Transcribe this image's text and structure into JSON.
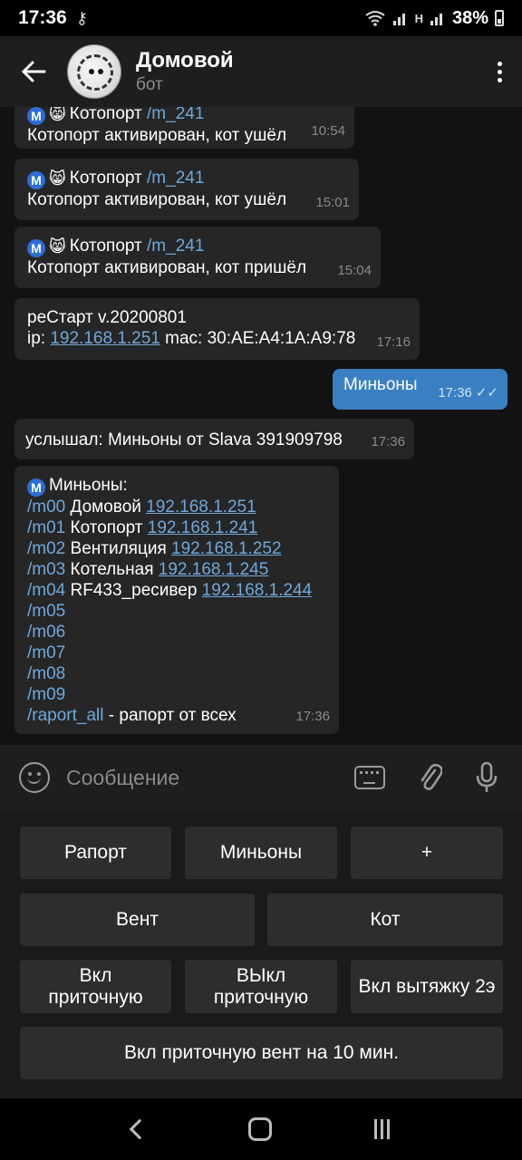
{
  "status_bar": {
    "time": "17:36",
    "battery": "38%",
    "signal_h": "H"
  },
  "header": {
    "title": "Домовой",
    "subtitle": "бот"
  },
  "messages": [
    {
      "lines": [
        {
          "badge": "M",
          "emoji": "😸",
          "text": "Котопорт",
          "link": "/m_241"
        },
        {
          "text": "Котопорт активирован, кот ушёл"
        }
      ],
      "time": "10:54"
    },
    {
      "lines": [
        {
          "badge": "M",
          "emoji": "😸",
          "text": "Котопорт",
          "link": "/m_241"
        },
        {
          "text": "Котопорт активирован, кот ушёл"
        }
      ],
      "time": "15:01"
    },
    {
      "lines": [
        {
          "badge": "M",
          "emoji": "😸",
          "text": "Котопорт",
          "link": "/m_241"
        },
        {
          "text": "Котопорт активирован, кот пришёл"
        }
      ],
      "time": "15:04"
    },
    {
      "lines": [
        {
          "text": "реСтарт v.20200801"
        },
        {
          "prefix": "ip:",
          "ulink": "192.168.1.251",
          "suffix": "mac: 30:AE:A4:1A:A9:78"
        }
      ],
      "time": "17:16"
    },
    {
      "outgoing": true,
      "text": "Миньоны",
      "time": "17:36"
    },
    {
      "text": "услышал: Миньоны от Slava 391909798",
      "time": "17:36"
    },
    {
      "header_badge": "M",
      "header_text": "Миньоны:",
      "rows": [
        {
          "cmd": "/m00",
          "label": "Домовой",
          "ip": "192.168.1.251"
        },
        {
          "cmd": "/m01",
          "label": "Котопорт",
          "ip": "192.168.1.241"
        },
        {
          "cmd": "/m02",
          "label": "Вентиляция",
          "ip": "192.168.1.252"
        },
        {
          "cmd": "/m03",
          "label": "Котельная",
          "ip": "192.168.1.245"
        },
        {
          "cmd": "/m04",
          "label": "RF433_ресивер",
          "ip": "192.168.1.244"
        },
        {
          "cmd": "/m05",
          "label": "",
          "ip": ""
        },
        {
          "cmd": "/m06",
          "label": "",
          "ip": ""
        },
        {
          "cmd": "/m07",
          "label": "",
          "ip": ""
        },
        {
          "cmd": "/m08",
          "label": "",
          "ip": ""
        },
        {
          "cmd": "/m09",
          "label": "",
          "ip": ""
        }
      ],
      "footer_cmd": "/raport_all",
      "footer_text": "- рапорт от всех",
      "time": "17:36"
    }
  ],
  "input": {
    "placeholder": "Сообщение"
  },
  "keyboard": {
    "row1": [
      "Рапорт",
      "Миньоны",
      "+"
    ],
    "row2": [
      "Вент",
      "Кот"
    ],
    "row3": [
      "Вкл приточную",
      "ВЫкл приточную",
      "Вкл вытяжку 2э"
    ],
    "row4": [
      "Вкл приточную вент на 10 мин."
    ]
  }
}
